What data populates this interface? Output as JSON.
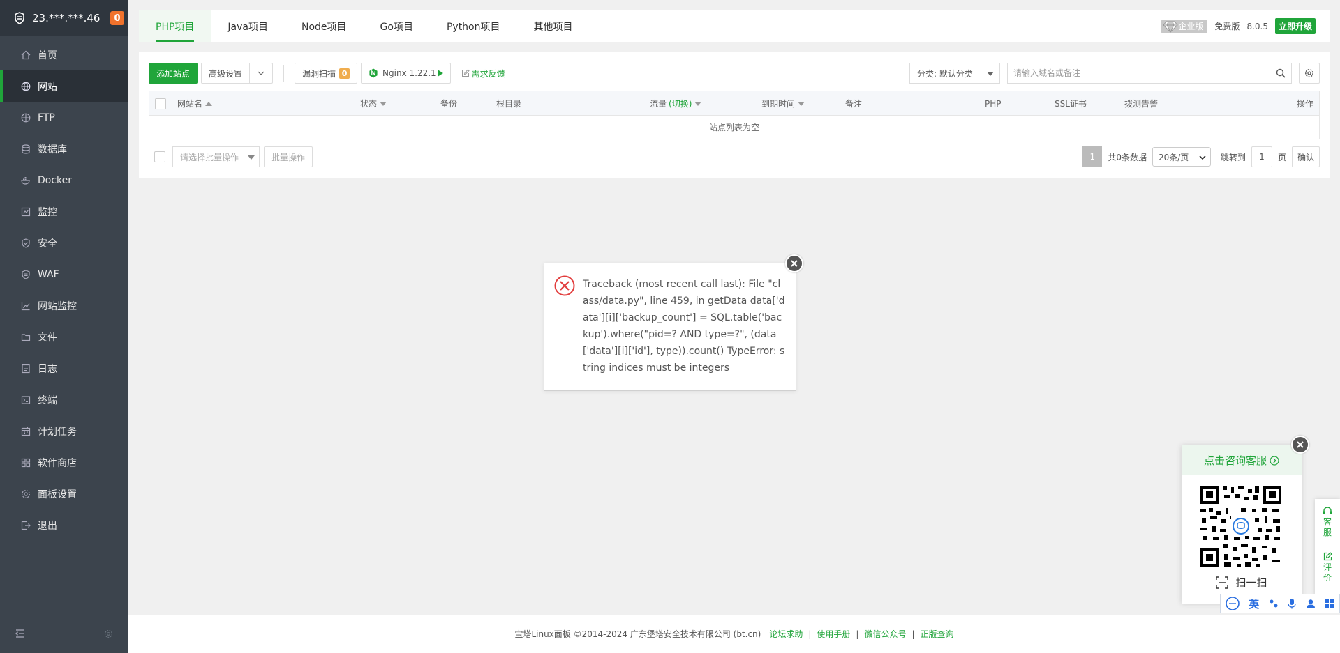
{
  "sidebar": {
    "ip": "23.***.***.46",
    "badge": "0",
    "items": [
      {
        "label": "首页",
        "icon": "home-icon"
      },
      {
        "label": "网站",
        "icon": "globe-icon"
      },
      {
        "label": "FTP",
        "icon": "ftp-icon"
      },
      {
        "label": "数据库",
        "icon": "database-icon"
      },
      {
        "label": "Docker",
        "icon": "docker-icon"
      },
      {
        "label": "监控",
        "icon": "monitor-icon"
      },
      {
        "label": "安全",
        "icon": "shield-icon"
      },
      {
        "label": "WAF",
        "icon": "waf-icon"
      },
      {
        "label": "网站监控",
        "icon": "chart-icon"
      },
      {
        "label": "文件",
        "icon": "folder-icon"
      },
      {
        "label": "日志",
        "icon": "log-icon"
      },
      {
        "label": "终端",
        "icon": "terminal-icon"
      },
      {
        "label": "计划任务",
        "icon": "calendar-icon"
      },
      {
        "label": "软件商店",
        "icon": "grid-icon"
      },
      {
        "label": "面板设置",
        "icon": "gear-icon"
      },
      {
        "label": "退出",
        "icon": "logout-icon"
      }
    ]
  },
  "tabs": [
    "PHP项目",
    "Java项目",
    "Node项目",
    "Go项目",
    "Python项目",
    "其他项目"
  ],
  "version_info": {
    "edition": "企业版",
    "free": "免费版",
    "version": "8.0.5",
    "upgrade": "立即升级"
  },
  "toolbar": {
    "add_site": "添加站点",
    "advanced": "高级设置",
    "vuln_scan": "漏洞扫描",
    "vuln_count": "0",
    "nginx": "Nginx 1.22.1",
    "feedback": "需求反馈",
    "category": "分类: 默认分类",
    "search_placeholder": "请输入域名或备注"
  },
  "table": {
    "headers": {
      "name": "网站名",
      "status": "状态",
      "backup": "备份",
      "root": "根目录",
      "traffic": "流量",
      "traffic_switch": "(切换)",
      "expire": "到期时间",
      "note": "备注",
      "php": "PHP",
      "ssl": "SSL证书",
      "alarm": "拨测告警",
      "ops": "操作"
    },
    "empty": "站点列表为空"
  },
  "batch": {
    "placeholder": "请选择批量操作",
    "button": "批量操作"
  },
  "pager": {
    "current": "1",
    "total": "共0条数据",
    "per_page": "20条/页",
    "jump_label": "跳转到",
    "jump_value": "1",
    "page_unit": "页",
    "confirm": "确认"
  },
  "error": {
    "message": "Traceback (most recent call last): File \"class/data.py\", line 459, in getData data['data'][i]['backup_count'] = SQL.table('backup').where(\"pid=? AND type=?\", (data['data'][i]['id'], type)).count() TypeError: string indices must be integers"
  },
  "footer": {
    "copyright": "宝塔Linux面板 ©2014-2024 广东堡塔安全技术有限公司 (bt.cn)",
    "links": [
      "论坛求助",
      "使用手册",
      "微信公众号",
      "正版查询"
    ]
  },
  "service": {
    "title": "点击咨询客服",
    "scan": "扫一扫",
    "side_items": [
      "客服",
      "评价"
    ]
  },
  "ime": {
    "lang": "英"
  },
  "colors": {
    "brand_green": "#20a53a",
    "sidebar_bg": "#3c444d",
    "badge_orange": "#f0722c",
    "error_red": "#e23d3d"
  }
}
